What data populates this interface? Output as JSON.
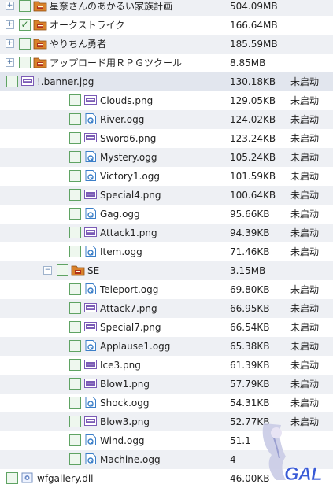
{
  "rows": [
    {
      "name": "星奈さんのあかるい家族計画",
      "size": "504.09MB",
      "status": "",
      "type": "folder",
      "indent": 0,
      "expander": "+",
      "checked": false,
      "shade": "alt"
    },
    {
      "name": "オークストライク",
      "size": "166.64MB",
      "status": "",
      "type": "folder",
      "indent": 0,
      "expander": "+",
      "checked": true,
      "shade": ""
    },
    {
      "name": "やりちん勇者",
      "size": "185.59MB",
      "status": "",
      "type": "folder",
      "indent": 0,
      "expander": "+",
      "checked": false,
      "shade": "alt"
    },
    {
      "name": "アップロード用ＲＰＧツクール",
      "size": "8.85MB",
      "status": "",
      "type": "folder",
      "indent": 0,
      "expander": "+",
      "checked": false,
      "shade": ""
    },
    {
      "name": "!.banner.jpg",
      "size": "130.18KB",
      "status": "未启动",
      "type": "image",
      "indent": 1,
      "expander": "",
      "checked": false,
      "shade": "sel"
    },
    {
      "name": "Clouds.png",
      "size": "129.05KB",
      "status": "未启动",
      "type": "image",
      "indent": 2,
      "expander": "",
      "checked": false,
      "shade": ""
    },
    {
      "name": "River.ogg",
      "size": "124.02KB",
      "status": "未启动",
      "type": "audio",
      "indent": 2,
      "expander": "",
      "checked": false,
      "shade": "alt"
    },
    {
      "name": "Sword6.png",
      "size": "123.24KB",
      "status": "未启动",
      "type": "image",
      "indent": 2,
      "expander": "",
      "checked": false,
      "shade": ""
    },
    {
      "name": "Mystery.ogg",
      "size": "105.24KB",
      "status": "未启动",
      "type": "audio",
      "indent": 2,
      "expander": "",
      "checked": false,
      "shade": "alt"
    },
    {
      "name": "Victory1.ogg",
      "size": "101.59KB",
      "status": "未启动",
      "type": "audio",
      "indent": 2,
      "expander": "",
      "checked": false,
      "shade": ""
    },
    {
      "name": "Special4.png",
      "size": "100.64KB",
      "status": "未启动",
      "type": "image",
      "indent": 2,
      "expander": "",
      "checked": false,
      "shade": "alt"
    },
    {
      "name": "Gag.ogg",
      "size": "95.66KB",
      "status": "未启动",
      "type": "audio",
      "indent": 2,
      "expander": "",
      "checked": false,
      "shade": ""
    },
    {
      "name": "Attack1.png",
      "size": "94.39KB",
      "status": "未启动",
      "type": "image",
      "indent": 2,
      "expander": "",
      "checked": false,
      "shade": "alt"
    },
    {
      "name": "Item.ogg",
      "size": "71.46KB",
      "status": "未启动",
      "type": "audio",
      "indent": 2,
      "expander": "",
      "checked": false,
      "shade": ""
    },
    {
      "name": "SE",
      "size": "3.15MB",
      "status": "",
      "type": "folder",
      "indent": 2,
      "expander": "−",
      "checked": false,
      "shade": "alt"
    },
    {
      "name": "Teleport.ogg",
      "size": "69.80KB",
      "status": "未启动",
      "type": "audio",
      "indent": 3,
      "expander": "",
      "checked": false,
      "shade": ""
    },
    {
      "name": "Attack7.png",
      "size": "66.95KB",
      "status": "未启动",
      "type": "image",
      "indent": 3,
      "expander": "",
      "checked": false,
      "shade": "alt"
    },
    {
      "name": "Special7.png",
      "size": "66.54KB",
      "status": "未启动",
      "type": "image",
      "indent": 3,
      "expander": "",
      "checked": false,
      "shade": ""
    },
    {
      "name": "Applause1.ogg",
      "size": "65.38KB",
      "status": "未启动",
      "type": "audio",
      "indent": 3,
      "expander": "",
      "checked": false,
      "shade": "alt"
    },
    {
      "name": "Ice3.png",
      "size": "61.39KB",
      "status": "未启动",
      "type": "image",
      "indent": 3,
      "expander": "",
      "checked": false,
      "shade": ""
    },
    {
      "name": "Blow1.png",
      "size": "57.79KB",
      "status": "未启动",
      "type": "image",
      "indent": 3,
      "expander": "",
      "checked": false,
      "shade": "alt"
    },
    {
      "name": "Shock.ogg",
      "size": "54.31KB",
      "status": "未启动",
      "type": "audio",
      "indent": 3,
      "expander": "",
      "checked": false,
      "shade": ""
    },
    {
      "name": "Blow3.png",
      "size": "52.77KB",
      "status": "未启动",
      "type": "image",
      "indent": 3,
      "expander": "",
      "checked": false,
      "shade": "alt"
    },
    {
      "name": "Wind.ogg",
      "size": "51.1",
      "status": "",
      "type": "audio",
      "indent": 3,
      "expander": "",
      "checked": false,
      "shade": ""
    },
    {
      "name": "Machine.ogg",
      "size": "4",
      "status": "",
      "type": "audio",
      "indent": 3,
      "expander": "",
      "checked": false,
      "shade": "alt"
    },
    {
      "name": "wfgallery.dll",
      "size": "46.00KB",
      "status": "",
      "type": "dll",
      "indent": 1,
      "expander": "",
      "checked": false,
      "shade": ""
    }
  ],
  "watermark": {
    "text": "GAL"
  },
  "colors": {
    "checkbox_border": "#5fa363",
    "check_mark": "#2e7d32",
    "folder": "#d9822b",
    "folder_badge": "#b0301c",
    "image_icon": "#7b5bb6",
    "audio_icon": "#3c7fc8"
  }
}
